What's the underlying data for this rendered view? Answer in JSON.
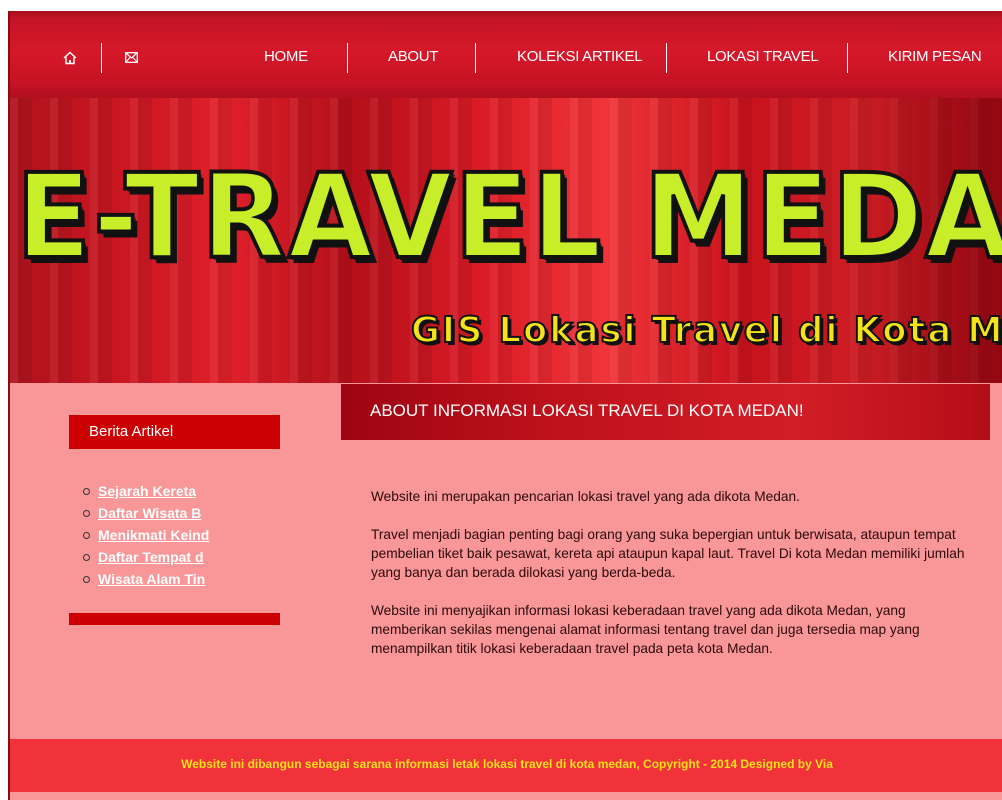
{
  "nav": {
    "home_icon": "home-icon",
    "mail_icon": "mail-icon",
    "links": [
      "HOME",
      "ABOUT",
      "KOLEKSI ARTIKEL",
      "LOKASI TRAVEL",
      "KIRIM PESAN"
    ]
  },
  "header": {
    "title": "E-TRAVEL MEDAN",
    "subtitle": "GIS Lokasi Travel di Kota Medan"
  },
  "sidebar": {
    "title": "Berita Artikel",
    "items": [
      "Sejarah Kereta",
      "Daftar Wisata B",
      "Menikmati Keind",
      "Daftar Tempat d",
      "Wisata Alam Tin"
    ]
  },
  "main": {
    "heading": "ABOUT INFORMASI LOKASI TRAVEL DI KOTA MEDAN!",
    "paragraphs": [
      "Website ini merupakan pencarian lokasi travel yang ada dikota Medan.",
      "Travel menjadi bagian penting bagi orang yang suka bepergian untuk berwisata, ataupun tempat pembelian tiket baik pesawat, kereta api ataupun kapal laut. Travel Di kota Medan memiliki jumlah yang banya dan berada dilokasi yang berda-beda.",
      "Website ini menyajikan informasi lokasi keberadaan travel yang ada dikota Medan, yang memberikan sekilas mengenai alamat informasi tentang travel dan juga tersedia map yang menampilkan titik lokasi keberadaan travel pada peta kota Medan."
    ]
  },
  "footer": {
    "text": "Website ini dibangun sebagai sarana informasi letak lokasi travel di kota medan, Copyright - 2014 Designed by Via"
  },
  "colors": {
    "nav_red": "#c41426",
    "page_bg": "#f99698",
    "sidebar_red": "#cc0002",
    "title_lime": "#c7ee28",
    "subtitle_yellow": "#f4e31a",
    "footer_red": "#f2323a",
    "footer_text": "#f5e11a"
  }
}
